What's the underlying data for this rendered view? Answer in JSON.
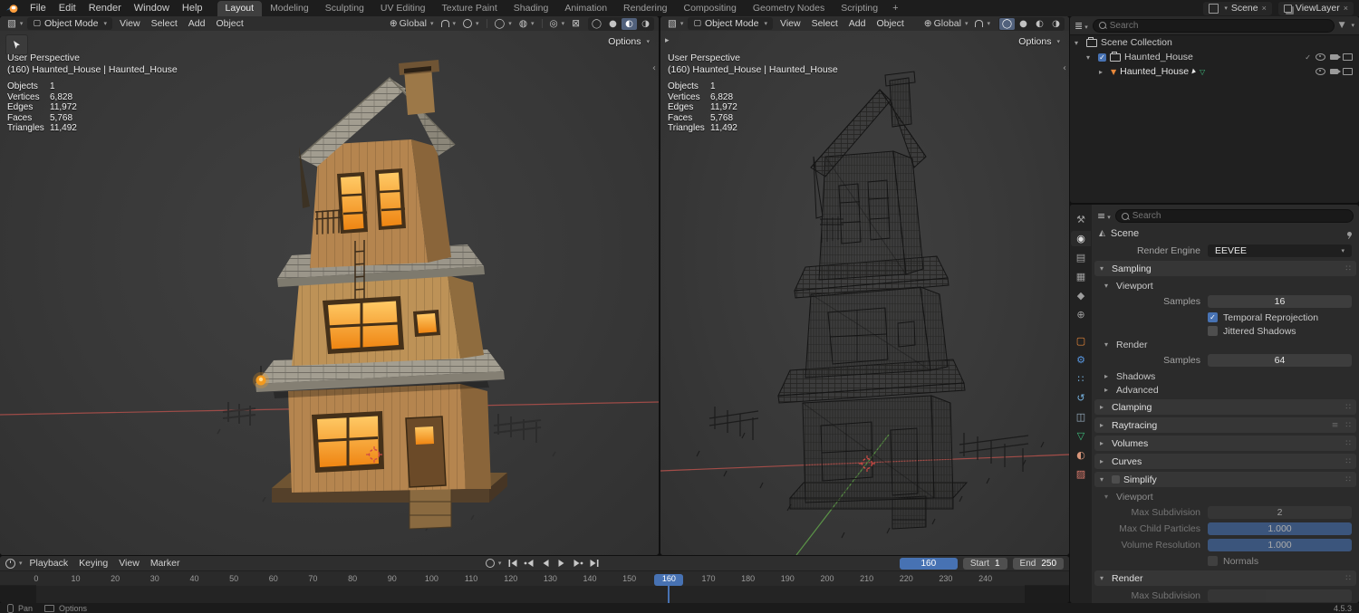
{
  "colors": {
    "accent": "#4772b3",
    "object_orange": "#e8883a",
    "mesh_green": "#3fbf7f",
    "axis_red": "#c0544e",
    "axis_green": "#6fae4e",
    "window_glow": "#f08c1a"
  },
  "topbar": {
    "menus": [
      "File",
      "Edit",
      "Render",
      "Window",
      "Help"
    ],
    "workspaces": [
      "Layout",
      "Modeling",
      "Sculpting",
      "UV Editing",
      "Texture Paint",
      "Shading",
      "Animation",
      "Rendering",
      "Compositing",
      "Geometry Nodes",
      "Scripting"
    ],
    "add_workspace": "+",
    "scene": {
      "label": "Scene"
    },
    "viewlayer": {
      "label": "ViewLayer"
    }
  },
  "viewport": {
    "mode": "Object Mode",
    "menus": [
      "View",
      "Select",
      "Add",
      "Object"
    ],
    "orientation": "Global",
    "options": "Options",
    "overlay": {
      "perspective": "User Perspective",
      "context": "(160) Haunted_House | Haunted_House"
    },
    "stats": [
      {
        "label": "Objects",
        "value": "1"
      },
      {
        "label": "Vertices",
        "value": "6,828"
      },
      {
        "label": "Edges",
        "value": "11,972"
      },
      {
        "label": "Faces",
        "value": "5,768"
      },
      {
        "label": "Triangles",
        "value": "11,492"
      }
    ]
  },
  "outliner": {
    "search_placeholder": "Search",
    "rows": [
      {
        "label": "Scene Collection"
      },
      {
        "label": "Haunted_House"
      },
      {
        "label": "Haunted_House"
      }
    ]
  },
  "properties": {
    "search_placeholder": "Search",
    "breadcrumb": "Scene",
    "render_engine": {
      "label": "Render Engine",
      "value": "EEVEE"
    },
    "sampling": {
      "title": "Sampling",
      "viewport": {
        "title": "Viewport",
        "samples_label": "Samples",
        "samples_value": "16",
        "temporal": "Temporal Reprojection",
        "jittered": "Jittered Shadows"
      },
      "render": {
        "title": "Render",
        "samples_label": "Samples",
        "samples_value": "64"
      },
      "shadows": "Shadows",
      "advanced": "Advanced"
    },
    "sections": {
      "clamping": "Clamping",
      "raytracing": "Raytracing",
      "volumes": "Volumes",
      "curves": "Curves"
    },
    "simplify": {
      "title": "Simplify",
      "viewport_title": "Viewport",
      "rows": [
        {
          "label": "Max Subdivision",
          "value": "2"
        },
        {
          "label": "Max Child Particles",
          "value": "1.000"
        },
        {
          "label": "Volume Resolution",
          "value": "1.000"
        }
      ],
      "normals": "Normals",
      "render_title": "Render",
      "partial_row_label": "Max Subdivision"
    }
  },
  "timeline": {
    "menus": [
      "Playback",
      "Keying",
      "View",
      "Marker"
    ],
    "frame": "160",
    "start_label": "Start",
    "start_value": "1",
    "end_label": "End",
    "end_value": "250",
    "ticks": [
      "0",
      "10",
      "20",
      "30",
      "40",
      "50",
      "60",
      "70",
      "80",
      "90",
      "100",
      "110",
      "120",
      "130",
      "140",
      "150",
      "160",
      "170",
      "180",
      "190",
      "200",
      "210",
      "220",
      "230",
      "240"
    ]
  },
  "statusbar": {
    "pan": "Pan",
    "options": "Options",
    "version": "4.5.3"
  }
}
